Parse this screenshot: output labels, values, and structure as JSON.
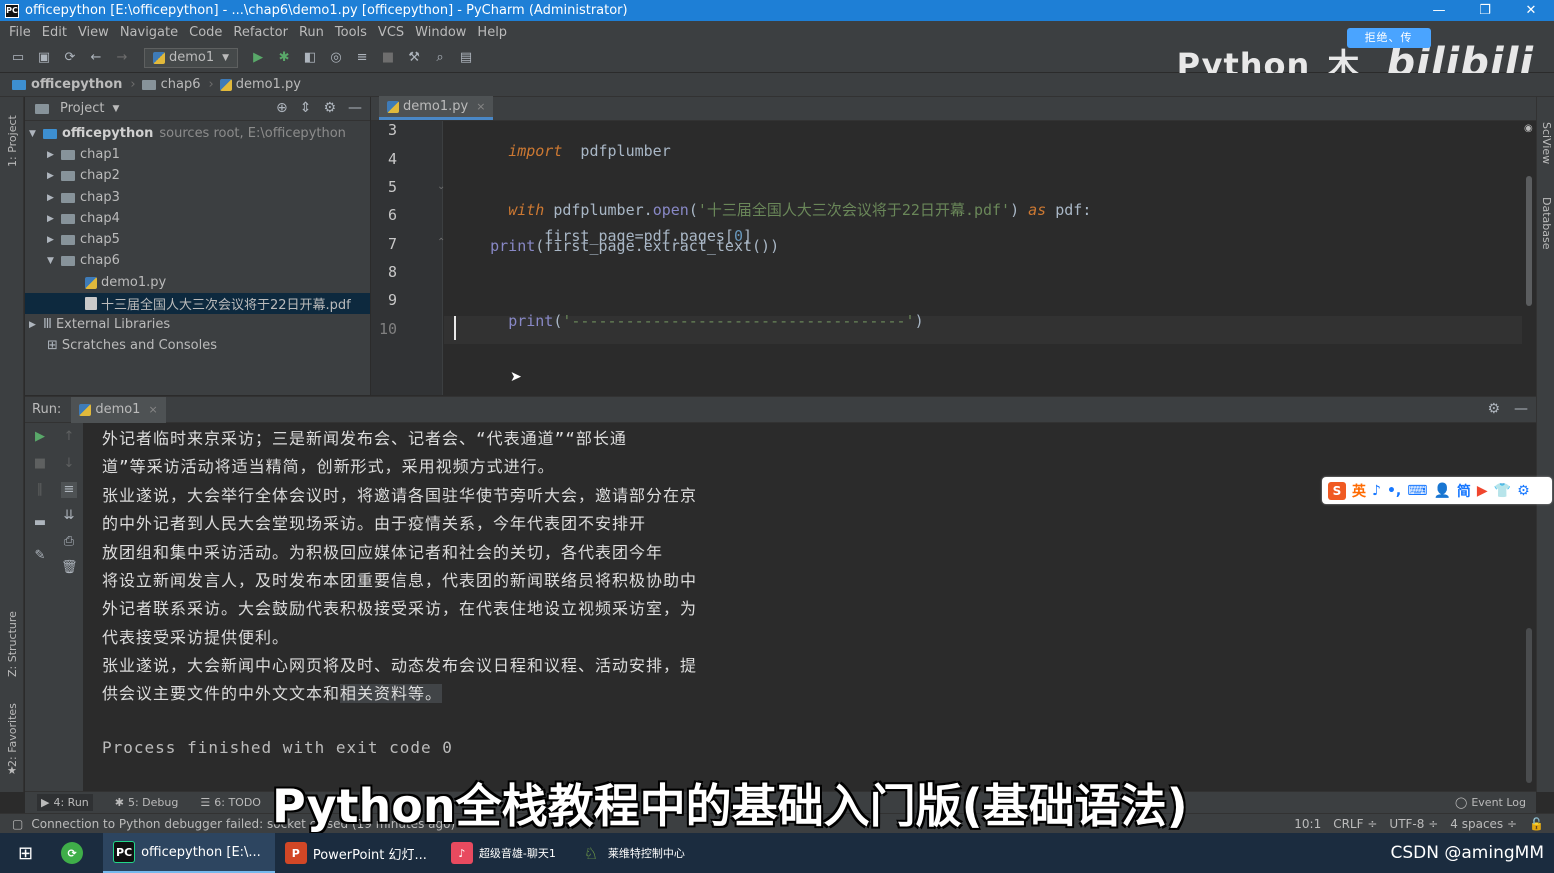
{
  "window": {
    "title": "officepython [E:\\officepython] - ...\\chap6\\demo1.py [officepython] - PyCharm (Administrator)",
    "controls": [
      "—",
      "❐",
      "✕"
    ]
  },
  "menu": [
    "File",
    "Edit",
    "View",
    "Navigate",
    "Code",
    "Refactor",
    "Run",
    "Tools",
    "VCS",
    "Window",
    "Help"
  ],
  "toolbar": {
    "run_config": "demo1"
  },
  "watermark": {
    "text": "Python_木",
    "badge": "拒绝、传",
    "brand": "bilibili"
  },
  "breadcrumb": [
    "officepython",
    "chap6",
    "demo1.py"
  ],
  "left_strip": {
    "project": "1: Project",
    "structure": "Z: Structure",
    "favorites": "2: Favorites"
  },
  "right_strip": {
    "sciview": "SciView",
    "database": "Database"
  },
  "project_panel": {
    "title": "Project",
    "root": {
      "name": "officepython",
      "note": "sources root,  E:\\officepython"
    },
    "folders": [
      "chap1",
      "chap2",
      "chap3",
      "chap4",
      "chap5",
      "chap6"
    ],
    "chap6_files": [
      "demo1.py",
      "十三届全国人大三次会议将于22日开幕.pdf"
    ],
    "external": "External Libraries",
    "scratches": "Scratches and Consoles"
  },
  "editor": {
    "tab": "demo1.py",
    "line_numbers": [
      "3",
      "4",
      "5",
      "6",
      "7",
      "8",
      "9",
      "10"
    ],
    "lines": {
      "l3_kw": "import",
      "l3_rest": "  pdfplumber",
      "l5_kw": "with",
      "l5_a": " pdfplumber.",
      "l5_fn": "open",
      "l5_b": "(",
      "l5_str": "'十三届全国人大三次会议将于22日开幕.pdf'",
      "l5_c": ")",
      "l5_as": "as",
      "l5_d": " pdf:",
      "l6_a": "    first_page=pdf.pages[",
      "l6_num": "0",
      "l6_b": "]",
      "l7_fn": "print",
      "l7_rest": "(first_page.extract_text())",
      "l9_fn": "print",
      "l9_a": "(",
      "l9_str": "'-------------------------------------'",
      "l9_b": ")"
    }
  },
  "run": {
    "label": "Run:",
    "tab": "demo1",
    "output": [
      "外记者临时来京采访；三是新闻发布会、记者会、“代表通道”“部长通",
      "道”等采访活动将适当精简，创新形式，采用视频方式进行。",
      "张业遂说，大会举行全体会议时，将邀请各国驻华使节旁听大会，邀请部分在京",
      "的中外记者到人民大会堂现场采访。由于疫情关系，今年代表团不安排开",
      "放团组和集中采访活动。为积极回应媒体记者和社会的关切，各代表团今年",
      "将设立新闻发言人，及时发布本团重要信息，代表团的新闻联络员将积极协助中",
      "外记者联系采访。大会鼓励代表积极接受采访，在代表住地设立视频采访室，为",
      "代表接受采访提供便利。",
      "张业遂说，大会新闻中心网页将及时、动态发布会议日程和议程、活动安排，提"
    ],
    "last_line_a": "供会议主要文件的中外文文本和",
    "last_line_hl": "相关资料等。",
    "finished": "Process finished with exit code 0"
  },
  "ime_bar": [
    "英",
    "♪",
    "•,",
    "⌨",
    "👤",
    "简",
    "▶",
    "👕",
    "⚙"
  ],
  "bottom_tabs": {
    "run": "4: Run",
    "debug": "5: Debug",
    "todo": "6: TODO",
    "event_log": "Event Log"
  },
  "status": {
    "message": "Connection to Python debugger failed: socket closed (19 minutes ago)",
    "position": "10:1",
    "line_sep": "CRLF ÷",
    "encoding": "UTF-8 ÷",
    "indent": "4 spaces ÷"
  },
  "subtitle": "Python全栈教程中的基础入门版(基础语法)",
  "taskbar": {
    "items": [
      "officepython [E:\\...",
      "PowerPoint 幻灯...",
      "超级音雄-聊天1",
      "莱维特控制中心"
    ],
    "corner": "CSDN @amingMM"
  }
}
